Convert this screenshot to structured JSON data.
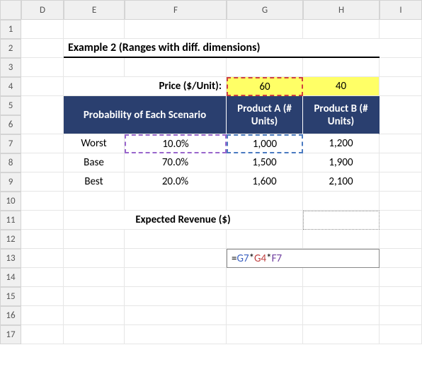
{
  "columns": [
    "D",
    "E",
    "F",
    "G",
    "H",
    "I"
  ],
  "rows": [
    "1",
    "2",
    "3",
    "4",
    "5",
    "6",
    "7",
    "8",
    "9",
    "10",
    "11",
    "12",
    "13",
    "14",
    "15",
    "16",
    "17"
  ],
  "title": "Example 2 (Ranges with diff. dimensions)",
  "price_label": "Price ($/Unit):",
  "price_a": "60",
  "price_b": "40",
  "hdr_scenario": "Probability of Each Scenario",
  "hdr_prod_a": "Product A (# Units)",
  "hdr_prod_b": "Product B (# Units)",
  "scenarios": [
    {
      "name": "Worst",
      "prob": "10.0%",
      "a": "1,000",
      "b": "1,200"
    },
    {
      "name": "Base",
      "prob": "70.0%",
      "a": "1,500",
      "b": "1,900"
    },
    {
      "name": "Best",
      "prob": "20.0%",
      "a": "1,600",
      "b": "2,100"
    }
  ],
  "expected_label": "Expected Revenue ($)",
  "formula": {
    "eq": "=G7*G4*F7",
    "r1": "G7",
    "r2": "G4",
    "r3": "F7"
  },
  "chart_data": {
    "type": "table",
    "prices": {
      "Product A": 60,
      "Product B": 40
    },
    "scenarios": {
      "Worst": {
        "probability": 0.1,
        "Product A units": 1000,
        "Product B units": 1200
      },
      "Base": {
        "probability": 0.7,
        "Product A units": 1500,
        "Product B units": 1900
      },
      "Best": {
        "probability": 0.2,
        "Product A units": 1600,
        "Product B units": 2100
      }
    }
  }
}
